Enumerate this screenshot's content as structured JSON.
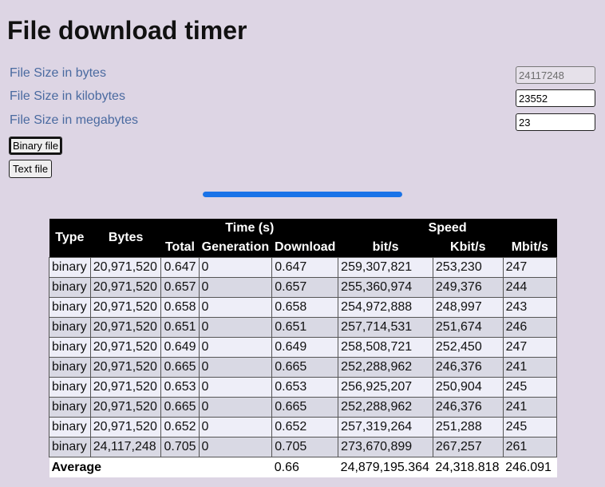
{
  "title": "File download timer",
  "fields": [
    {
      "label": "File Size in bytes",
      "value": "24117248",
      "readonly": true
    },
    {
      "label": "File Size in kilobytes",
      "value": "23552",
      "readonly": false
    },
    {
      "label": "File Size in megabytes",
      "value": "23",
      "readonly": false
    }
  ],
  "buttons": {
    "binary": "Binary file",
    "text": "Text file"
  },
  "progress": {
    "fraction": 1.0
  },
  "table": {
    "headers": {
      "type": "Type",
      "bytes": "Bytes",
      "time_group": "Time (s)",
      "speed_group": "Speed",
      "total": "Total",
      "generation": "Generation",
      "download": "Download",
      "bits": "bit/s",
      "kbits": "Kbit/s",
      "mbits": "Mbit/s"
    },
    "rows": [
      [
        "binary",
        "20,971,520",
        "0.647",
        "0",
        "0.647",
        "259,307,821",
        "253,230",
        "247"
      ],
      [
        "binary",
        "20,971,520",
        "0.657",
        "0",
        "0.657",
        "255,360,974",
        "249,376",
        "244"
      ],
      [
        "binary",
        "20,971,520",
        "0.658",
        "0",
        "0.658",
        "254,972,888",
        "248,997",
        "243"
      ],
      [
        "binary",
        "20,971,520",
        "0.651",
        "0",
        "0.651",
        "257,714,531",
        "251,674",
        "246"
      ],
      [
        "binary",
        "20,971,520",
        "0.649",
        "0",
        "0.649",
        "258,508,721",
        "252,450",
        "247"
      ],
      [
        "binary",
        "20,971,520",
        "0.665",
        "0",
        "0.665",
        "252,288,962",
        "246,376",
        "241"
      ],
      [
        "binary",
        "20,971,520",
        "0.653",
        "0",
        "0.653",
        "256,925,207",
        "250,904",
        "245"
      ],
      [
        "binary",
        "20,971,520",
        "0.665",
        "0",
        "0.665",
        "252,288,962",
        "246,376",
        "241"
      ],
      [
        "binary",
        "20,971,520",
        "0.652",
        "0",
        "0.652",
        "257,319,264",
        "251,288",
        "245"
      ],
      [
        "binary",
        "24,117,248",
        "0.705",
        "0",
        "0.705",
        "273,670,899",
        "267,257",
        "261"
      ]
    ],
    "average": {
      "label": "Average",
      "download": "0.66",
      "bits": "24,879,195.364",
      "kbits": "24,318.818",
      "mbits": "246.091"
    }
  }
}
